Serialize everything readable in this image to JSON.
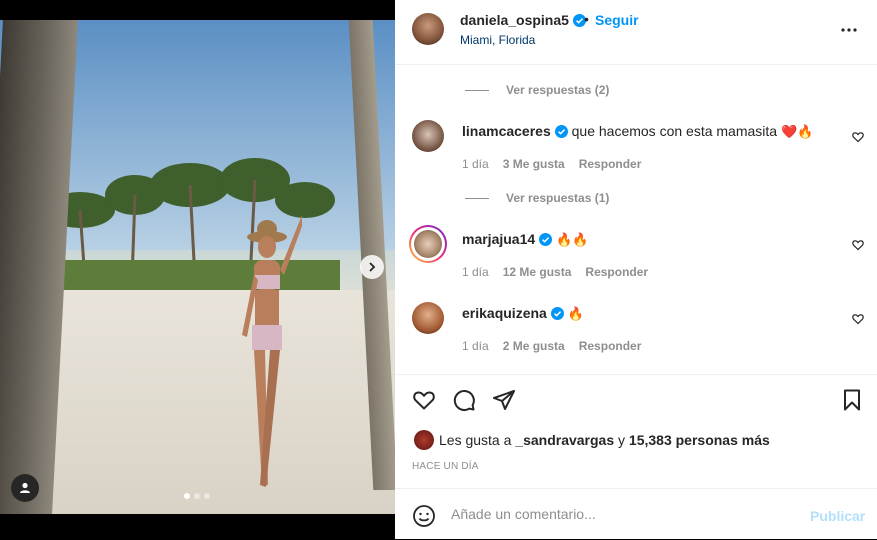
{
  "post": {
    "author": "daniela_ospina5",
    "follow_label": "Seguir",
    "separator": "•",
    "location": "Miami, Florida"
  },
  "comments": [
    {
      "replies_label": "Ver respuestas (2)"
    },
    {
      "username": "linamcaceres",
      "text": "que hacemos con esta mamasita",
      "emoji": "❤️🔥",
      "age": "1 día",
      "likes": "3 Me gusta",
      "reply_label": "Responder",
      "replies_label": "Ver respuestas (1)"
    },
    {
      "username": "marjajua14",
      "text": "",
      "emoji": "🔥🔥",
      "age": "1 día",
      "likes": "12 Me gusta",
      "reply_label": "Responder"
    },
    {
      "username": "erikaquizena",
      "text": "",
      "emoji": "🔥",
      "age": "1 día",
      "likes": "2 Me gusta",
      "reply_label": "Responder"
    }
  ],
  "likes": {
    "prefix": "Les gusta a",
    "user": "_sandravargas",
    "connector": "y",
    "count": "15,383 personas más"
  },
  "timestamp": "HACE UN DÍA",
  "comment_box": {
    "placeholder": "Añade un comentario...",
    "post_label": "Publicar"
  },
  "carousel": {
    "slides": 3,
    "active": 1
  },
  "colors": {
    "accent": "#0095f6",
    "verified": "#0095f6",
    "text": "#262626",
    "muted": "#8e8e8e"
  },
  "icons": [
    "user-tag-icon",
    "chevron-right-icon",
    "more-options-icon",
    "verified-icon",
    "heart-icon",
    "comment-icon",
    "share-icon",
    "bookmark-icon",
    "emoji-icon"
  ]
}
